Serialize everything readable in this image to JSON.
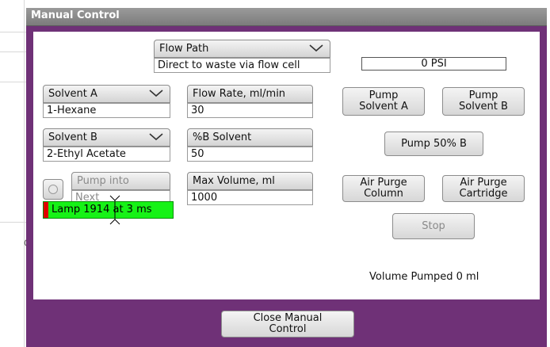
{
  "window": {
    "title": "Manual Control"
  },
  "flow_path": {
    "label": "Flow Path",
    "value": "Direct to waste via flow cell"
  },
  "pressure": {
    "value": "0 PSI"
  },
  "solvent_a": {
    "label": "Solvent A",
    "value": "1-Hexane"
  },
  "solvent_b": {
    "label": "Solvent B",
    "value": "2-Ethyl Acetate"
  },
  "flow_rate": {
    "label": "Flow Rate, ml/min",
    "value": "30"
  },
  "percent_b": {
    "label": "%B Solvent",
    "value": "50"
  },
  "max_volume": {
    "label": "Max Volume, ml",
    "value": "1000"
  },
  "pump_into": {
    "label": "Pump into",
    "value": "Next"
  },
  "buttons": {
    "pump_a_line1": "Pump",
    "pump_a_line2": "Solvent A",
    "pump_b_line1": "Pump",
    "pump_b_line2": "Solvent B",
    "pump_50": "Pump 50% B",
    "air_purge_column_line1": "Air Purge",
    "air_purge_column_line2": "Column",
    "air_purge_cartridge_line1": "Air Purge",
    "air_purge_cartridge_line2": "Cartridge",
    "stop": "Stop",
    "close_line1": "Close Manual",
    "close_line2": "Control"
  },
  "lamp": {
    "text": "Lamp 1914 at 3 ms",
    "status_color": "#16f216",
    "indicator_color": "#e00000"
  },
  "volume_pumped": {
    "text": "Volume Pumped 0 ml"
  },
  "colors": {
    "window_frame": "#6f3177",
    "panel": "#ffffff"
  },
  "background": {
    "stray_char": "C"
  }
}
